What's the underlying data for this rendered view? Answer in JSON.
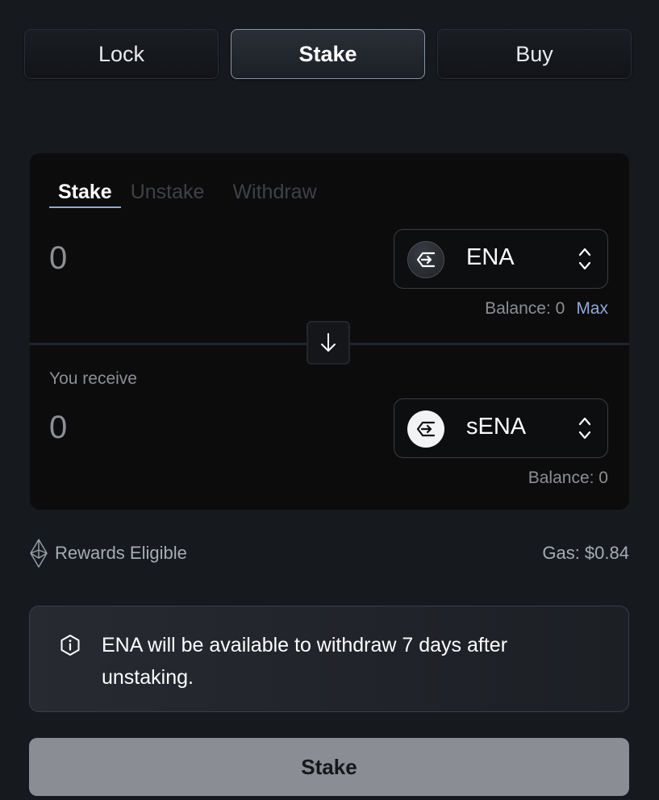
{
  "top_tabs": [
    {
      "label": "Lock"
    },
    {
      "label": "Stake"
    },
    {
      "label": "Buy"
    }
  ],
  "card": {
    "sub_tabs": [
      {
        "label": "Stake"
      },
      {
        "label": "Unstake"
      },
      {
        "label": "Withdraw"
      }
    ],
    "from": {
      "amount": "0",
      "token": "ENA",
      "balance": "Balance: 0",
      "max_label": "Max",
      "icon": "ena-icon"
    },
    "receive_label": "You receive",
    "to": {
      "amount": "0",
      "token": "sENA",
      "balance": "Balance: 0",
      "icon": "sena-icon"
    }
  },
  "rewards_label": "Rewards Eligible",
  "gas_label": "Gas: $0.84",
  "notice_text": "ENA will be available to withdraw 7 days after unstaking.",
  "submit_label": "Stake",
  "colors": {
    "accent": "#8fa8d9",
    "background": "#16191e",
    "card": "#0c0c0d"
  }
}
